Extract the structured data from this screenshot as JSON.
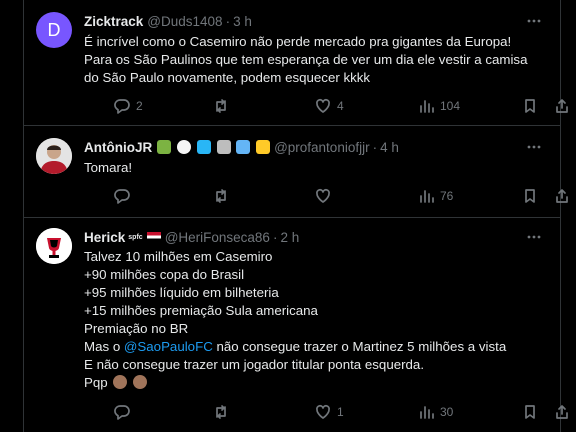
{
  "tweets": [
    {
      "name": "Zicktrack",
      "handle": "@Duds1408",
      "time": "3 h",
      "avatar_letter": "D",
      "avatar_color": "#7856ff",
      "lines": [
        "É incrível como o Casemiro não perde mercado pra gigantes da Europa!",
        "Para os São Paulinos que tem esperança de ver um dia ele vestir a camisa",
        "do São Paulo novamente, podem esquecer kkkk"
      ],
      "replies": "2",
      "retweets": "",
      "likes": "4",
      "views": "104"
    },
    {
      "name": "AntônioJR",
      "handle": "@profantoniofjjr",
      "time": "4 h",
      "lines": [
        "Tomara!"
      ],
      "replies": "",
      "retweets": "",
      "likes": "",
      "views": "76"
    },
    {
      "name": "Herick",
      "badge": "spfc",
      "handle": "@HeriFonseca86",
      "time": "2 h",
      "lines": [
        "Talvez 10 milhões em Casemiro",
        "+90 milhões copa do Brasil",
        "+95 milhões líquido em bilheteria",
        "+15 milhões premiação Sula americana",
        "Premiação no BR"
      ],
      "line6_pre": "Mas o ",
      "mention": "@SaoPauloFC",
      "line6_post": " não consegue trazer o Martinez 5 milhões a vista",
      "line7": "E não consegue trazer um jogador titular ponta esquerda.",
      "line8": "Pqp",
      "replies": "",
      "retweets": "",
      "likes": "1",
      "views": "30"
    }
  ],
  "colors": {
    "accent": "#1d9bf0",
    "muted": "#71767b",
    "border": "#2f3336"
  }
}
